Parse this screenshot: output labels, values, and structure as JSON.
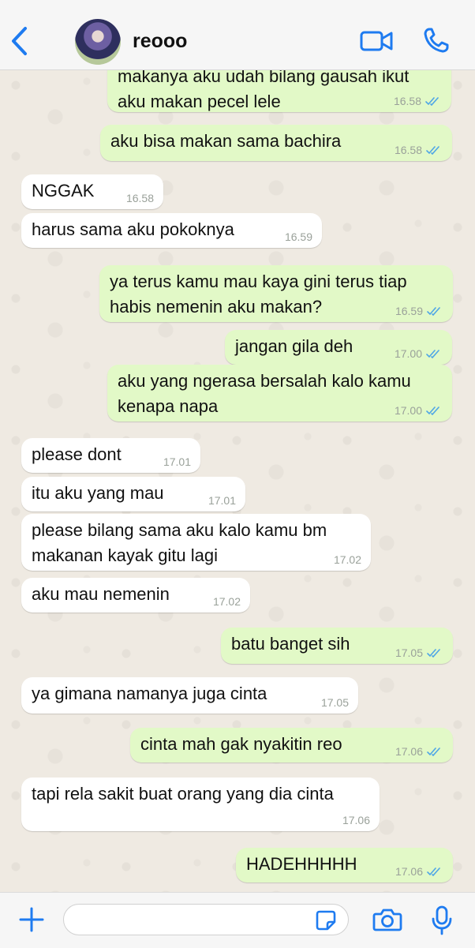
{
  "header": {
    "contact_name": "reooo",
    "back_icon": "chevron-left-icon",
    "video_icon": "video-camera-icon",
    "call_icon": "phone-icon",
    "accent": "#1e7bf0"
  },
  "messages": [
    {
      "dir": "out",
      "text": "makanya aku udah bilang gausah ikut\naku makan pecel lele",
      "time": "16.58",
      "read": true
    },
    {
      "dir": "out",
      "text": "aku bisa makan sama bachira",
      "time": "16.58",
      "read": true
    },
    {
      "dir": "in",
      "text": "NGGAK",
      "time": "16.58"
    },
    {
      "dir": "in",
      "text": "harus sama aku pokoknya",
      "time": "16.59"
    },
    {
      "dir": "out",
      "text": "ya terus kamu mau kaya gini terus tiap\nhabis nemenin aku makan?",
      "time": "16.59",
      "read": true
    },
    {
      "dir": "out",
      "text": "jangan gila deh",
      "time": "17.00",
      "read": true
    },
    {
      "dir": "out",
      "text": "aku yang ngerasa bersalah kalo kamu\nkenapa napa",
      "time": "17.00",
      "read": true
    },
    {
      "dir": "in",
      "text": "please dont",
      "time": "17.01"
    },
    {
      "dir": "in",
      "text": "itu aku yang mau",
      "time": "17.01"
    },
    {
      "dir": "in",
      "text": "please bilang sama aku kalo kamu bm\nmakanan kayak gitu lagi",
      "time": "17.02"
    },
    {
      "dir": "in",
      "text": "aku mau nemenin",
      "time": "17.02"
    },
    {
      "dir": "out",
      "text": "batu banget sih",
      "time": "17.05",
      "read": true
    },
    {
      "dir": "in",
      "text": "ya gimana namanya juga cinta",
      "time": "17.05"
    },
    {
      "dir": "out",
      "text": "cinta mah gak nyakitin reo",
      "time": "17.06",
      "read": true
    },
    {
      "dir": "in",
      "text": "tapi rela sakit buat orang yang dia cinta",
      "time": "17.06"
    },
    {
      "dir": "out",
      "text": "HADEHHHHH",
      "time": "17.06",
      "read": true
    }
  ],
  "composer": {
    "placeholder": "",
    "plus_icon": "plus-icon",
    "sticker_icon": "sticker-icon",
    "camera_icon": "camera-icon",
    "mic_icon": "microphone-icon"
  },
  "colors": {
    "sent_bubble": "#e2f9c7",
    "received_bubble": "#ffffff",
    "read_check": "#4fa6e6"
  }
}
